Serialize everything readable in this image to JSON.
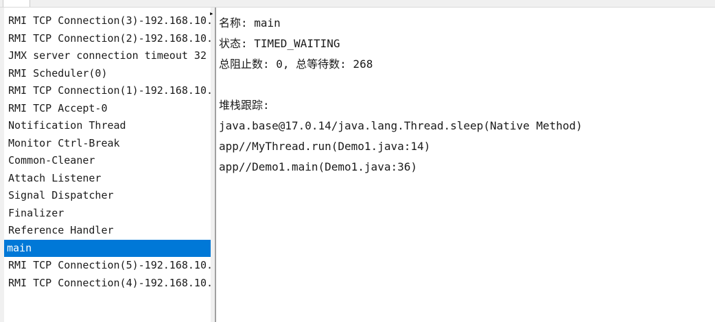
{
  "threads": [
    {
      "name": "RMI TCP Connection(3)-192.168.10.",
      "selected": false
    },
    {
      "name": "RMI TCP Connection(2)-192.168.10.",
      "selected": false
    },
    {
      "name": "JMX server connection timeout 32",
      "selected": false
    },
    {
      "name": "RMI Scheduler(0)",
      "selected": false
    },
    {
      "name": "RMI TCP Connection(1)-192.168.10.",
      "selected": false
    },
    {
      "name": "RMI TCP Accept-0",
      "selected": false
    },
    {
      "name": "Notification Thread",
      "selected": false
    },
    {
      "name": "Monitor Ctrl-Break",
      "selected": false
    },
    {
      "name": "Common-Cleaner",
      "selected": false
    },
    {
      "name": "Attach Listener",
      "selected": false
    },
    {
      "name": "Signal Dispatcher",
      "selected": false
    },
    {
      "name": "Finalizer",
      "selected": false
    },
    {
      "name": "Reference Handler",
      "selected": false
    },
    {
      "name": "main",
      "selected": true
    },
    {
      "name": "RMI TCP Connection(5)-192.168.10.",
      "selected": false
    },
    {
      "name": "RMI TCP Connection(4)-192.168.10.",
      "selected": false
    }
  ],
  "detail": {
    "name_line": "名称: main",
    "state_line": "状态: TIMED_WAITING",
    "counts_line": "总阻止数: 0, 总等待数: 268",
    "stack_header": "堆栈跟踪:",
    "stack": [
      "java.base@17.0.14/java.lang.Thread.sleep(Native Method)",
      "app//MyThread.run(Demo1.java:14)",
      "app//Demo1.main(Demo1.java:36)"
    ]
  },
  "colors": {
    "selection": "#0078d7",
    "divider": "#a0a0a0"
  }
}
